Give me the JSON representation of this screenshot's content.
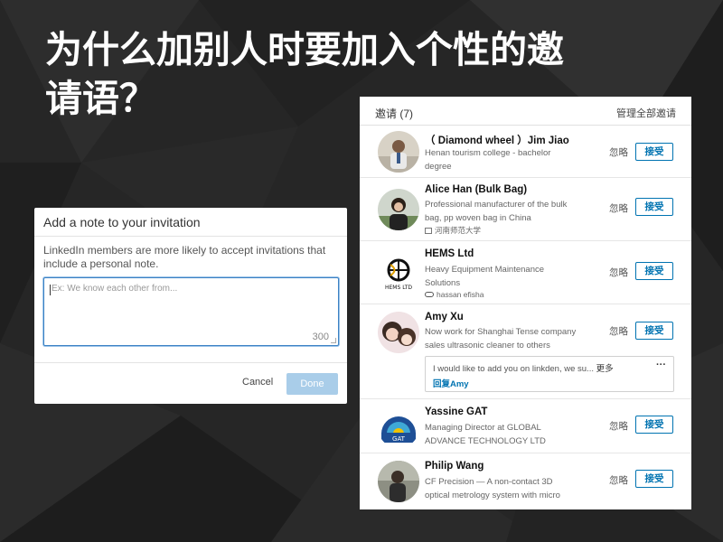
{
  "slide": {
    "title_line1": "为什么加别人时要加入个性的邀",
    "title_line2": "请语？"
  },
  "dialog": {
    "title": "Add a note to your invitation",
    "description": "LinkedIn members are more likely to accept invitations that include a personal note.",
    "note_placeholder": "Ex: We know each other from...",
    "char_count": "300",
    "cancel_label": "Cancel",
    "done_label": "Done"
  },
  "invitations": {
    "header_title": "邀请 (7)",
    "manage_all_label": "管理全部邀请",
    "ignore_label": "忽略",
    "accept_label": "接受",
    "items": [
      {
        "name": "（ Diamond wheel ）Jim Jiao",
        "desc_line1": "Henan tourism college - bachelor",
        "desc_line2": "degree",
        "avatar": "person-photo"
      },
      {
        "name": "Alice Han (Bulk Bag)",
        "desc_line1": "Professional manufacturer of the bulk",
        "desc_line2": "bag, pp woven bag in China",
        "sub": "河南师范大学",
        "sub_icon": "school-icon",
        "avatar": "person-photo"
      },
      {
        "name": "HEMS Ltd",
        "desc_line1": "Heavy Equipment Maintenance",
        "desc_line2": "Solutions",
        "sub": "hassan efisha",
        "sub_icon": "connection-icon",
        "avatar": "company-logo",
        "logo_text": "HEMS LTD"
      },
      {
        "name": "Amy Xu",
        "desc_line1": "Now work for Shanghai Tense company",
        "desc_line2": "sales ultrasonic cleaner to others",
        "message": "I would like to add you on linkden, we su...",
        "message_more": "更多",
        "message_reply": "回复Amy",
        "avatar": "person-photo"
      },
      {
        "name": "Yassine GAT",
        "desc_line1": "Managing Director at GLOBAL",
        "desc_line2": "ADVANCE TECHNOLOGY LTD",
        "avatar": "company-logo",
        "logo_text": "GAT"
      },
      {
        "name": "Philip Wang",
        "desc_line1": "CF Precision — A non-contact 3D",
        "desc_line2": "optical metrology system with micro",
        "avatar": "person-photo"
      }
    ]
  }
}
